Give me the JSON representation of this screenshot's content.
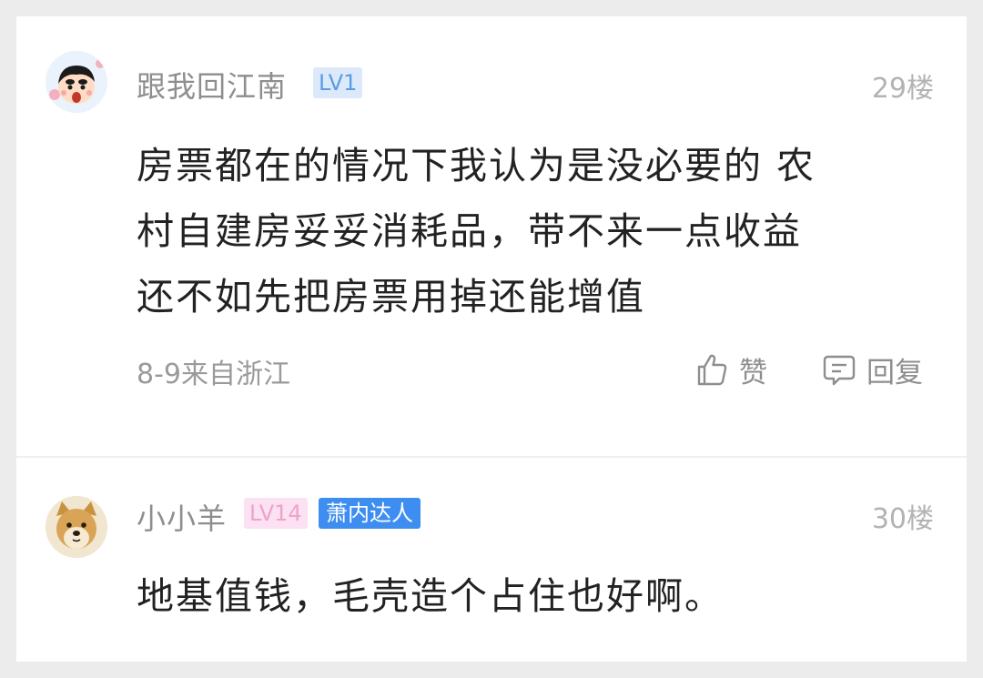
{
  "comments": [
    {
      "username": "跟我回江南",
      "level": "LV1",
      "floor": "29楼",
      "lines": [
        "房票都在的情况下我认为是没必要的  农",
        "村自建房妥妥消耗品，带不来一点收益",
        "还不如先把房票用掉还能增值"
      ],
      "meta": "8-9来自浙江",
      "like_label": "赞",
      "reply_label": "回复",
      "avatar": "crayon-shin-chan-avatar",
      "like_icon": "thumbs-up-icon",
      "reply_icon": "comment-bubble-icon"
    },
    {
      "username": "小小羊",
      "level": "LV14",
      "title_badge": "萧内达人",
      "floor": "30楼",
      "lines": [
        "地基值钱，毛壳造个占住也好啊。"
      ],
      "avatar": "shiba-doge-avatar"
    }
  ],
  "colors": {
    "background": "#ececec",
    "card": "#ffffff",
    "username": "#8e8e8e",
    "lv1_badge_bg": "#dbe9fa",
    "lv1_badge_text": "#5b9be6",
    "lv14_badge_bg": "#fbe1f1",
    "lv14_badge_text": "#eea3cc",
    "talent_badge_bg": "#3d8ef0",
    "content_text": "#222222"
  }
}
